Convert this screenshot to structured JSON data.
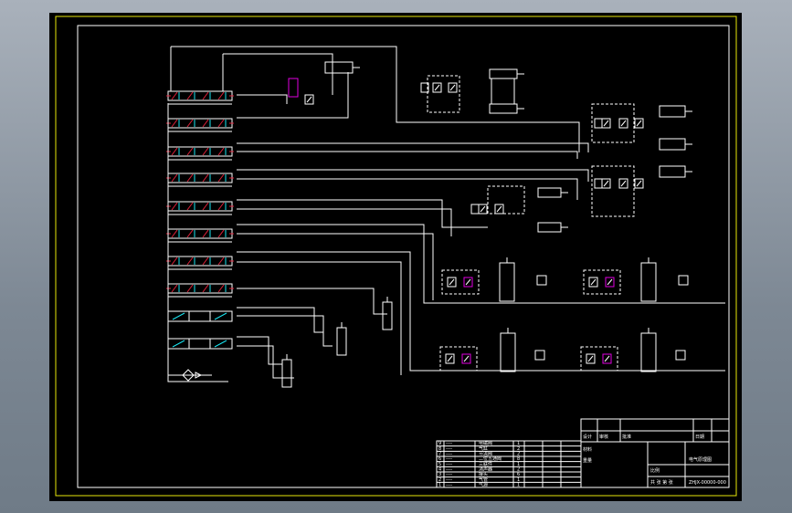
{
  "drawing": {
    "background": "#000000",
    "frame_color": "#e6e60a",
    "line_color": "#ffffff",
    "valve_accent_colors": [
      "#e0203a",
      "#19e5f0"
    ],
    "sensor_color": "#e000e0"
  },
  "title_block": {
    "title": "电气原理图",
    "drawing_number": "ZHJX-00000-000",
    "sheet_label": "共 张 第 张",
    "scale_label": "比例",
    "designer_label": "设计",
    "checker_label": "审核",
    "approver_label": "批准",
    "date_label": "日期",
    "material_label": "材料",
    "weight_label": "重量"
  },
  "parts_list": {
    "rows": [
      {
        "no": "9",
        "code": "----",
        "name": "电磁阀",
        "qty": "1"
      },
      {
        "no": "8",
        "code": "----",
        "name": "气缸",
        "qty": "2"
      },
      {
        "no": "7",
        "code": "----",
        "name": "节流阀",
        "qty": "2"
      },
      {
        "no": "6",
        "code": "----",
        "name": "二位五通阀",
        "qty": "8"
      },
      {
        "no": "5",
        "code": "----",
        "name": "三联件",
        "qty": "1"
      },
      {
        "no": "4",
        "code": "----",
        "name": "消声器",
        "qty": "2"
      },
      {
        "no": "3",
        "code": "----",
        "name": "接头",
        "qty": "6"
      },
      {
        "no": "2",
        "code": "----",
        "name": "气管",
        "qty": "1"
      },
      {
        "no": "1",
        "code": "----",
        "name": "气源",
        "qty": "1"
      }
    ]
  }
}
